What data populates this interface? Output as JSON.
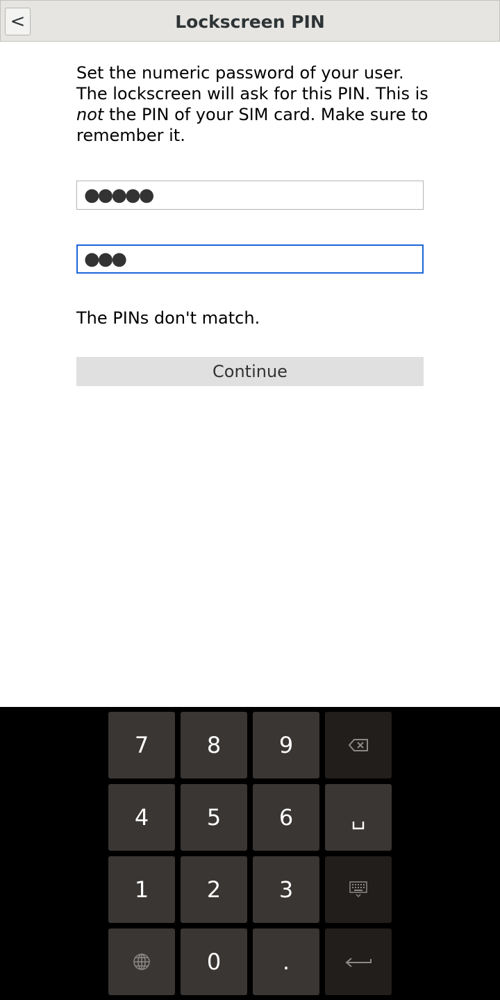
{
  "header": {
    "back_label": "<",
    "title": "Lockscreen PIN"
  },
  "instructions": {
    "part1": "Set the numeric password of your user. The lockscreen will ask for this PIN. This is ",
    "emphasis": "not",
    "part2": " the PIN of your SIM card. Make sure to remember it."
  },
  "pin_fields": {
    "first_value": "●●●●●",
    "second_value": "●●●"
  },
  "error_message": "The PINs don't match.",
  "continue_label": "Continue",
  "keyboard": {
    "keys": {
      "seven": "7",
      "eight": "8",
      "nine": "9",
      "four": "4",
      "five": "5",
      "six": "6",
      "one": "1",
      "two": "2",
      "three": "3",
      "zero": "0",
      "period": ".",
      "space": "␣"
    },
    "icons": {
      "backspace": "backspace-icon",
      "hide_keyboard": "keyboard-hide-icon",
      "language": "globe-icon",
      "enter": "enter-icon"
    }
  },
  "colors": {
    "focus_border": "#1a66d8",
    "header_bg": "#e6e5e2",
    "key_bg": "#3a3634",
    "key_dark_bg": "#211e1c",
    "keyboard_bg": "#000000"
  }
}
